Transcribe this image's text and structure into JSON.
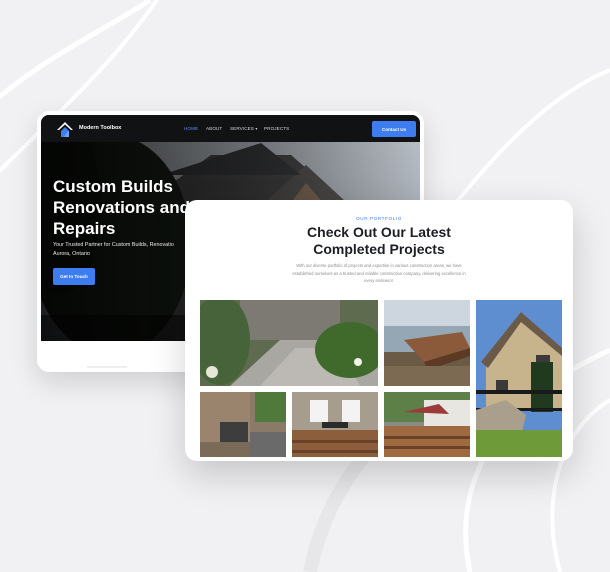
{
  "homepage": {
    "brand": "Modern Toolbox",
    "nav": [
      {
        "label": "HOME",
        "active": true
      },
      {
        "label": "ABOUT",
        "active": false
      },
      {
        "label": "SERVICES",
        "active": false,
        "has_dropdown": true
      },
      {
        "label": "PROJECTS",
        "active": false
      }
    ],
    "cta_label": "Contact Us",
    "hero_title": "Custom Builds\nRenovations and\nRepairs",
    "hero_subtitle": "Your Trusted Partner for Custom Builds, Renovatio\nAurora, Ontario",
    "hero_button": "Get In Touch"
  },
  "portfolio": {
    "eyebrow": "OUR PORTFOLIO",
    "title": "Check Out Our Latest\nCompleted Projects",
    "description": "With our diverse portfolio of projects and expertise in various construction areas, we have established ourselves as a trusted and reliable construction company, delivering excellence in every endeavor."
  },
  "colors": {
    "accent": "#3d7df0",
    "nav_background": "#111214",
    "page_background": "#f1f1f3"
  },
  "icons": {
    "brand_logo": "house-roof-logo-icon",
    "dropdown": "chevron-down-icon"
  }
}
